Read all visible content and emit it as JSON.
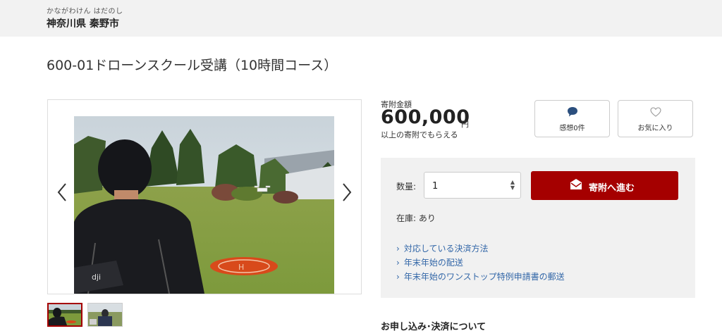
{
  "region": {
    "kana": "かながわけん はだのし",
    "name": "神奈川県 秦野市"
  },
  "item": {
    "title": "600-01ドローンスクール受講（10時間コース）"
  },
  "gallery": {
    "prev_icon": "chevron-left-icon",
    "next_icon": "chevron-right-icon",
    "photo": "drone-flight-field-photo",
    "thumbnails": [
      "drone-field-thumbnail",
      "drone-pilot-thumbnail"
    ],
    "selected_thumbnail": 1
  },
  "amount": {
    "label": "寄附金額",
    "value": "600,000",
    "unit": "円",
    "note": "以上の寄附でもらえる"
  },
  "actions": {
    "review": {
      "icon": "speech-bubble-icon",
      "label": "感想0件"
    },
    "favorite": {
      "icon": "heart-icon",
      "label": "お気に入り"
    }
  },
  "order": {
    "quantity_label": "数量:",
    "quantity_value": "1",
    "quantity_caret": "▲▼",
    "donate_icon": "envelope-icon",
    "donate_label": "寄附へ進む",
    "stock_text": "在庫: あり",
    "links": [
      "対応している決済方法",
      "年末年始の配送",
      "年末年始のワンストップ特例申請書の郵送"
    ],
    "link_chevron": "›"
  },
  "apply_heading": "お申し込み･決済について",
  "colors": {
    "accent": "#a50000",
    "link": "#3367a8",
    "panel": "#f1f1f1",
    "header": "#f2f2f2"
  }
}
